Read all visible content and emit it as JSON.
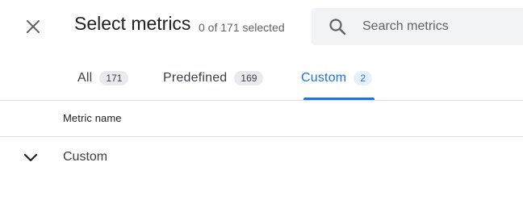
{
  "header": {
    "title": "Select metrics",
    "selection_status": "0 of 171 selected",
    "close_icon": "close-icon"
  },
  "search": {
    "placeholder": "Search metrics",
    "value": "",
    "icon": "search-icon"
  },
  "tabs": [
    {
      "label": "All",
      "count": "171",
      "active": false
    },
    {
      "label": "Predefined",
      "count": "169",
      "active": false
    },
    {
      "label": "Custom",
      "count": "2",
      "active": true
    }
  ],
  "table": {
    "column_header": "Metric name",
    "groups": [
      {
        "label": "Custom",
        "expanded": true,
        "icon": "chevron-down-icon"
      }
    ]
  },
  "colors": {
    "accent": "#1a73e8",
    "text_primary": "#202124",
    "text_secondary": "#5f6368",
    "search_bg": "#f1f3f4",
    "badge_bg": "#e8eaed",
    "badge_active_bg": "#e8f0fe",
    "divider": "#dadce0"
  }
}
